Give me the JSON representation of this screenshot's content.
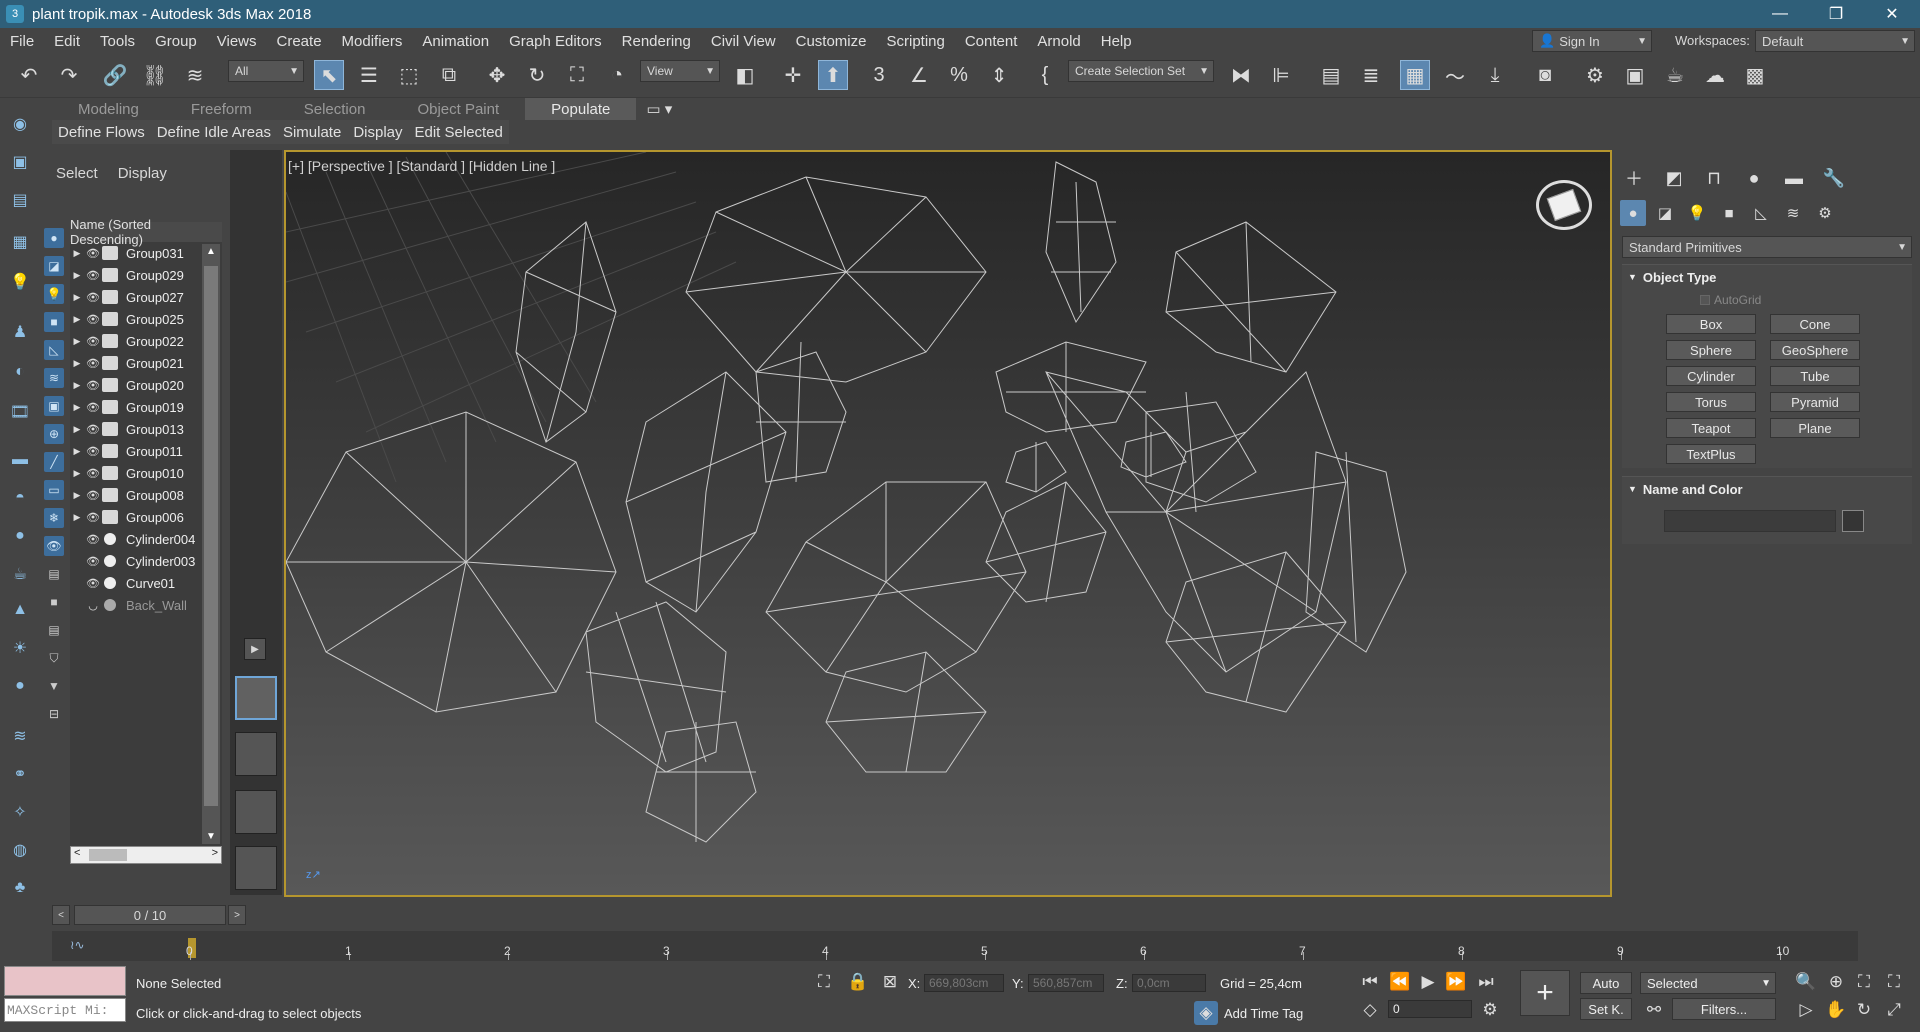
{
  "window": {
    "title": "plant tropik.max - Autodesk 3ds Max 2018",
    "min": "—",
    "max": "❐",
    "close": "✕"
  },
  "menu": [
    "File",
    "Edit",
    "Tools",
    "Group",
    "Views",
    "Create",
    "Modifiers",
    "Animation",
    "Graph Editors",
    "Rendering",
    "Civil View",
    "Customize",
    "Scripting",
    "Content",
    "Arnold",
    "Help"
  ],
  "account": {
    "signin": "Sign In",
    "workspaces_label": "Workspaces:",
    "workspace": "Default"
  },
  "toolbar": {
    "filter": "All",
    "refcoord": "View",
    "selection_set": "Create Selection Set"
  },
  "ribbon": {
    "tabs": [
      "Modeling",
      "Freeform",
      "Selection",
      "Object Paint",
      "Populate"
    ],
    "active_tab": "Populate",
    "subtabs": [
      "Define Flows",
      "Define Idle Areas",
      "Simulate",
      "Display",
      "Edit Selected"
    ]
  },
  "scene_explorer": {
    "tabs": [
      "Select",
      "Display"
    ],
    "header": "Name (Sorted Descending)",
    "items": [
      {
        "name": "Group031",
        "type": "group"
      },
      {
        "name": "Group029",
        "type": "group"
      },
      {
        "name": "Group027",
        "type": "group"
      },
      {
        "name": "Group025",
        "type": "group"
      },
      {
        "name": "Group022",
        "type": "group"
      },
      {
        "name": "Group021",
        "type": "group"
      },
      {
        "name": "Group020",
        "type": "group"
      },
      {
        "name": "Group019",
        "type": "group"
      },
      {
        "name": "Group013",
        "type": "group"
      },
      {
        "name": "Group011",
        "type": "group"
      },
      {
        "name": "Group010",
        "type": "group"
      },
      {
        "name": "Group008",
        "type": "group"
      },
      {
        "name": "Group006",
        "type": "group"
      },
      {
        "name": "Cylinder004",
        "type": "object"
      },
      {
        "name": "Cylinder003",
        "type": "object"
      },
      {
        "name": "Curve01",
        "type": "object"
      },
      {
        "name": "Back_Wall",
        "type": "hidden"
      }
    ]
  },
  "viewport": {
    "label": "[+] [Perspective ] [Standard ] [Hidden Line ]"
  },
  "command_panel": {
    "category": "Standard Primitives",
    "object_type_title": "Object Type",
    "autogrid": "AutoGrid",
    "buttons": [
      "Box",
      "Cone",
      "Sphere",
      "GeoSphere",
      "Cylinder",
      "Tube",
      "Torus",
      "Pyramid",
      "Teapot",
      "Plane",
      "TextPlus"
    ],
    "name_color_title": "Name and Color"
  },
  "timeline": {
    "slider": "0 / 10",
    "ticks": [
      "0",
      "1",
      "2",
      "3",
      "4",
      "5",
      "6",
      "7",
      "8",
      "9",
      "10"
    ]
  },
  "status": {
    "maxscript": "MAXScript Mi:",
    "selection": "None Selected",
    "prompt": "Click or click-and-drag to select objects",
    "x_label": "X:",
    "x": "669,803cm",
    "y_label": "Y:",
    "y": "560,857cm",
    "z_label": "Z:",
    "z": "0,0cm",
    "grid": "Grid = 25,4cm",
    "add_time_tag": "Add Time Tag",
    "auto": "Auto",
    "set_key": "Set K.",
    "key_filter": "Selected",
    "filters": "Filters...",
    "frame": "0"
  }
}
